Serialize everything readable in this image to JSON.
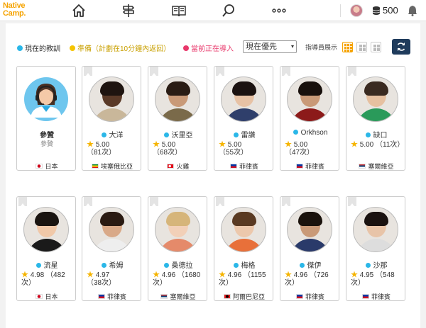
{
  "header": {
    "logo_line1": "Native",
    "logo_line2": "Camp.",
    "coins": "500",
    "nav_icons": [
      "home-icon",
      "signpost-icon",
      "book-icon",
      "search-icon",
      "more-icon"
    ]
  },
  "filters": {
    "legend_available": "現在的教訓",
    "legend_preparing": "準備（計劃在10分鐘內返回）",
    "legend_in_lesson": "當前正在導入",
    "sort_selected": "現在優先",
    "display_label": "指導員展示",
    "colors": {
      "available": "#2ab7e8",
      "preparing": "#f5c400",
      "in_lesson": "#e8386b",
      "accent": "#f5a300"
    }
  },
  "teachers": [
    {
      "name": "參贊",
      "status": "",
      "subtitle": "參贊",
      "rating": "",
      "count": "",
      "country": "日本",
      "flag": "jp",
      "skin": "#f4c9a8",
      "hair": "#5b3a29",
      "shirt": "#2aa8e0"
    },
    {
      "name": "大洋",
      "status": "available",
      "subtitle": "",
      "rating": "5.00",
      "count": "（81次）",
      "country": "埃塞俄比亞",
      "flag": "et",
      "skin": "#5a3a28",
      "hair": "#1e1410",
      "shirt": "#c9b79a"
    },
    {
      "name": "沃里亞",
      "status": "available",
      "subtitle": "",
      "rating": "5.00",
      "count": "（68次）",
      "country": "火雞",
      "flag": "tr",
      "skin": "#c99a78",
      "hair": "#2a1c14",
      "shirt": "#7a6a4a"
    },
    {
      "name": "雷讚",
      "status": "available",
      "subtitle": "",
      "rating": "5.00",
      "count": "（55次）",
      "country": "菲律賓",
      "flag": "ph",
      "skin": "#e7c2a5",
      "hair": "#1b1210",
      "shirt": "#2f3f6b"
    },
    {
      "name": "Orkhson",
      "status": "available",
      "subtitle": "",
      "rating": "5.00",
      "count": "（47次）",
      "country": "菲律賓",
      "flag": "ph",
      "skin": "#c99a78",
      "hair": "#18100c",
      "shirt": "#8c1a1a"
    },
    {
      "name": "缺口",
      "status": "available",
      "subtitle": "",
      "rating": "5.00",
      "count": "（11次）",
      "country": "塞爾維亞",
      "flag": "rs",
      "skin": "#e6c0a0",
      "hair": "#3a2a20",
      "shirt": "#2a9a5a"
    },
    {
      "name": "流星",
      "status": "available",
      "subtitle": "",
      "rating": "4.98",
      "count": "（482次）",
      "country": "日本",
      "flag": "jp",
      "skin": "#f0c8a8",
      "hair": "#1a1410",
      "shirt": "#1a1a1a"
    },
    {
      "name": "希姆",
      "status": "available",
      "subtitle": "",
      "rating": "4.97",
      "count": "（38次）",
      "country": "菲律賓",
      "flag": "ph",
      "skin": "#d9a988",
      "hair": "#2a1a12",
      "shirt": "#eee"
    },
    {
      "name": "桑德拉",
      "status": "available",
      "subtitle": "",
      "rating": "4.96",
      "count": "（1680次）",
      "country": "塞爾維亞",
      "flag": "rs",
      "skin": "#f2d0b8",
      "hair": "#d6b57a",
      "shirt": "#e58a6a"
    },
    {
      "name": "梅格",
      "status": "available",
      "subtitle": "",
      "rating": "4.96",
      "count": "（1155次）",
      "country": "阿爾巴尼亞",
      "flag": "al",
      "skin": "#ecc8ac",
      "hair": "#5a3a22",
      "shirt": "#e8703a"
    },
    {
      "name": "傑伊",
      "status": "available",
      "subtitle": "",
      "rating": "4.96",
      "count": "（726次）",
      "country": "菲律賓",
      "flag": "ph",
      "skin": "#c99a78",
      "hair": "#1a120c",
      "shirt": "#2a3a6a"
    },
    {
      "name": "沙那",
      "status": "available",
      "subtitle": "",
      "rating": "4.95",
      "count": "（548次）",
      "country": "菲律賓",
      "flag": "ph",
      "skin": "#e8c4a8",
      "hair": "#1a1210",
      "shirt": "#ddd"
    }
  ]
}
